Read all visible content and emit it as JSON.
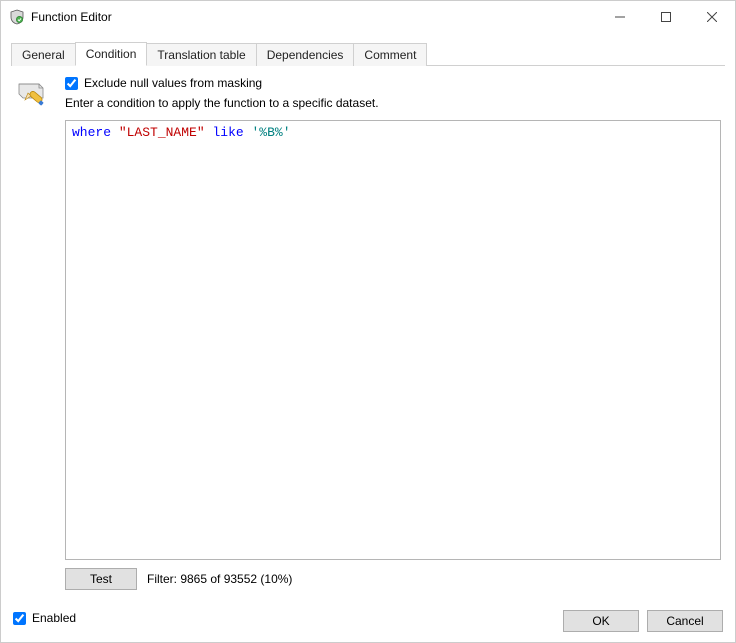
{
  "window": {
    "title": "Function Editor"
  },
  "tabs": {
    "items": [
      {
        "label": "General"
      },
      {
        "label": "Condition"
      },
      {
        "label": "Translation table"
      },
      {
        "label": "Dependencies"
      },
      {
        "label": "Comment"
      }
    ],
    "activeIndex": 1
  },
  "condition": {
    "excludeNullLabel": "Exclude null values from masking",
    "excludeNullChecked": true,
    "instruction": "Enter a condition to apply the function to a specific dataset.",
    "code": {
      "tokens": [
        {
          "text": "where",
          "cls": "kw-blue"
        },
        {
          "text": " ",
          "cls": ""
        },
        {
          "text": "\"LAST_NAME\"",
          "cls": "kw-red"
        },
        {
          "text": " ",
          "cls": ""
        },
        {
          "text": "like",
          "cls": "kw-blue"
        },
        {
          "text": " ",
          "cls": ""
        },
        {
          "text": "'%B%'",
          "cls": "lit-teal"
        }
      ]
    },
    "testButton": "Test",
    "filterResult": "Filter: 9865 of 93552 (10%)"
  },
  "footer": {
    "enabledLabel": "Enabled",
    "enabledChecked": true,
    "ok": "OK",
    "cancel": "Cancel"
  }
}
